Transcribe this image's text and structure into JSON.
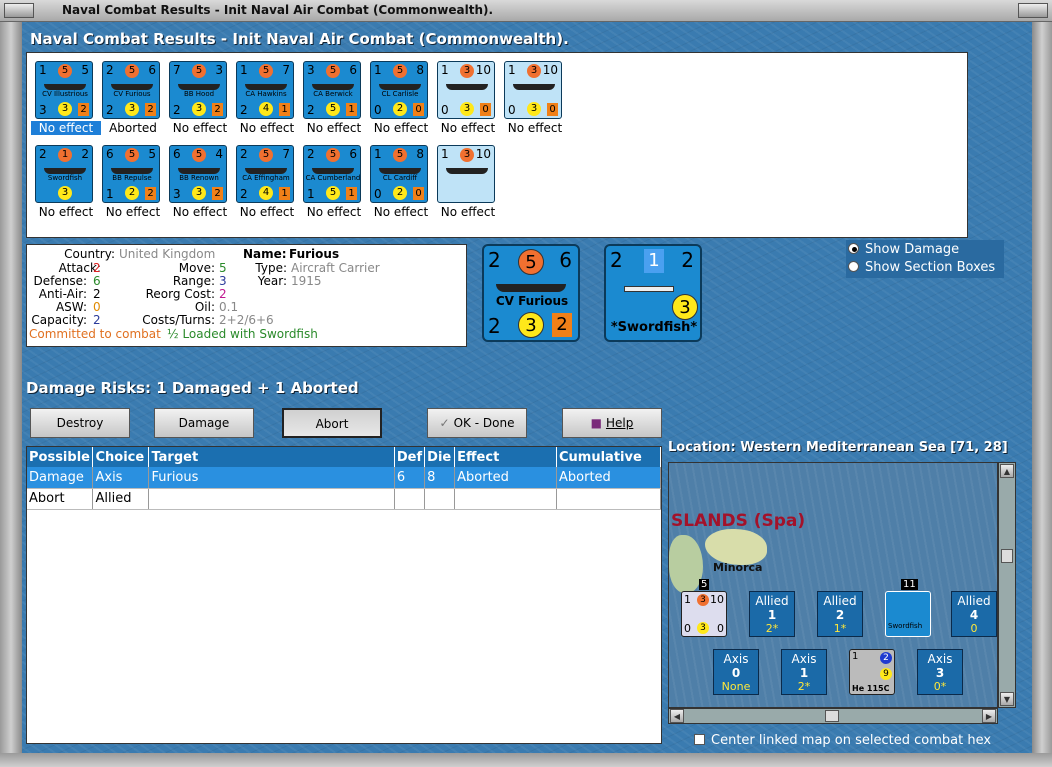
{
  "window": {
    "title": "Naval Combat Results - Init Naval Air Combat (Commonwealth)."
  },
  "heading": "Naval Combat Results - Init Naval Air Combat (Commonwealth).",
  "units": [
    {
      "name": "CV Illustrious",
      "tl": "1",
      "red": "5",
      "tr": "5",
      "bl": "3",
      "yel": "3",
      "org": "2",
      "effect": "No effect",
      "white": false,
      "sel": true
    },
    {
      "name": "CV Furious",
      "tl": "2",
      "red": "5",
      "tr": "6",
      "bl": "2",
      "yel": "3",
      "org": "2",
      "effect": "Aborted",
      "white": false,
      "sel": false
    },
    {
      "name": "BB Hood",
      "tl": "7",
      "red": "5",
      "tr": "3",
      "bl": "2",
      "yel": "3",
      "org": "2",
      "effect": "No effect",
      "white": false,
      "sel": false
    },
    {
      "name": "CA Hawkins",
      "tl": "1",
      "red": "5",
      "tr": "7",
      "bl": "2",
      "yel": "4",
      "org": "1",
      "effect": "No effect",
      "white": false,
      "sel": false
    },
    {
      "name": "CA Berwick",
      "tl": "3",
      "red": "5",
      "tr": "6",
      "bl": "2",
      "yel": "5",
      "org": "1",
      "effect": "No effect",
      "white": false,
      "sel": false
    },
    {
      "name": "CL Carlisle",
      "tl": "1",
      "red": "5",
      "tr": "8",
      "bl": "0",
      "yel": "2",
      "org": "0",
      "effect": "No effect",
      "white": false,
      "sel": false
    },
    {
      "name": "",
      "tl": "1",
      "red": "3",
      "tr": "10",
      "bl": "0",
      "yel": "3",
      "org": "0",
      "effect": "No effect",
      "white": true,
      "sel": false
    },
    {
      "name": "",
      "tl": "1",
      "red": "3",
      "tr": "10",
      "bl": "0",
      "yel": "3",
      "org": "0",
      "effect": "No effect",
      "white": true,
      "sel": false
    },
    {
      "name": "Swordfish",
      "tl": "2",
      "red": "1",
      "tr": "2",
      "bl": "",
      "yel": "3",
      "org": "",
      "effect": "No effect",
      "white": false,
      "sel": false
    },
    {
      "name": "BB Repulse",
      "tl": "6",
      "red": "5",
      "tr": "5",
      "bl": "1",
      "yel": "2",
      "org": "2",
      "effect": "No effect",
      "white": false,
      "sel": false
    },
    {
      "name": "BB Renown",
      "tl": "6",
      "red": "5",
      "tr": "4",
      "bl": "3",
      "yel": "3",
      "org": "2",
      "effect": "No effect",
      "white": false,
      "sel": false
    },
    {
      "name": "CA Effingham",
      "tl": "2",
      "red": "5",
      "tr": "7",
      "bl": "2",
      "yel": "4",
      "org": "1",
      "effect": "No effect",
      "white": false,
      "sel": false
    },
    {
      "name": "CA Cumberland",
      "tl": "2",
      "red": "5",
      "tr": "6",
      "bl": "1",
      "yel": "5",
      "org": "1",
      "effect": "No effect",
      "white": false,
      "sel": false
    },
    {
      "name": "CL Cardiff",
      "tl": "1",
      "red": "5",
      "tr": "8",
      "bl": "0",
      "yel": "2",
      "org": "0",
      "effect": "No effect",
      "white": false,
      "sel": false
    },
    {
      "name": "",
      "tl": "1",
      "red": "3",
      "tr": "10",
      "bl": "",
      "yel": "",
      "org": "",
      "effect": "No effect",
      "white": true,
      "sel": false
    }
  ],
  "info": {
    "country_label": "Country:",
    "country": "United Kingdom",
    "attack_label": "Attack:",
    "attack": "2",
    "defense_label": "Defense:",
    "defense": "6",
    "antiair_label": "Anti-Air:",
    "antiair": "2",
    "asw_label": "ASW:",
    "asw": "0",
    "capacity_label": "Capacity:",
    "capacity": "2",
    "name_label": "Name:",
    "name": "Furious",
    "type_label": "Type:",
    "type": "Aircraft Carrier",
    "year_label": "Year:",
    "year": "1915",
    "move_label": "Move:",
    "move": "5",
    "range_label": "Range:",
    "range": "3",
    "reorg_label": "Reorg Cost:",
    "reorg": "2",
    "oil_label": "Oil:",
    "oil": "0.1",
    "costs_label": "Costs/Turns:",
    "costs": "2+2/6+6",
    "committed": "Committed to combat",
    "loaded": "½ Loaded with Swordfish"
  },
  "big_ship": {
    "tl": "2",
    "red": "5",
    "tr": "6",
    "name": "CV Furious",
    "bl": "2",
    "yel": "3",
    "org": "2"
  },
  "big_air": {
    "tl": "2",
    "blue": "1",
    "tr": "2",
    "yel": "3",
    "name": "*Swordfish*"
  },
  "options": {
    "show_damage": "Show Damage",
    "show_sections": "Show Section Boxes"
  },
  "risks": "Damage Risks:  1 Damaged + 1 Aborted",
  "buttons": {
    "destroy": "Destroy",
    "damage": "Damage",
    "abort": "Abort",
    "ok": "OK - Done",
    "help": "Help"
  },
  "table": {
    "headers": [
      "Possible",
      "Choice",
      "Target",
      "Def",
      "Die",
      "Effect",
      "Cumulative"
    ],
    "rows": [
      [
        "Damage",
        "Axis",
        "Furious",
        "6",
        "8",
        "Aborted",
        "Aborted"
      ],
      [
        "Abort",
        "Allied",
        "",
        "",
        "",
        "",
        ""
      ]
    ]
  },
  "location": "Location:  Western Mediterranean Sea [71, 28]",
  "map": {
    "region": "SLANDS (Spa)",
    "island": "Minorca",
    "stack_count_1": "5",
    "stack_count_2": "11",
    "allied": [
      {
        "a": "Allied",
        "b": "1",
        "c": "2*"
      },
      {
        "a": "Allied",
        "b": "2",
        "c": "1*"
      },
      {
        "a": "Allied",
        "b": "4",
        "c": "0"
      }
    ],
    "axis": [
      {
        "a": "Axis",
        "b": "0",
        "c": "None"
      },
      {
        "a": "Axis",
        "b": "1",
        "c": "2*"
      },
      {
        "a": "Axis",
        "b": "3",
        "c": "0*"
      }
    ],
    "he_name": "He 115C",
    "he_blue": "2",
    "he_yel": "9",
    "he_tl": "1",
    "sword_name": "Swordfish",
    "stack_tl": "1",
    "stack_red": "3",
    "stack_tr": "10",
    "stack_bl": "0",
    "stack_yel": "3",
    "stack_br": "0"
  },
  "center_link": "Center linked map on selected combat hex"
}
